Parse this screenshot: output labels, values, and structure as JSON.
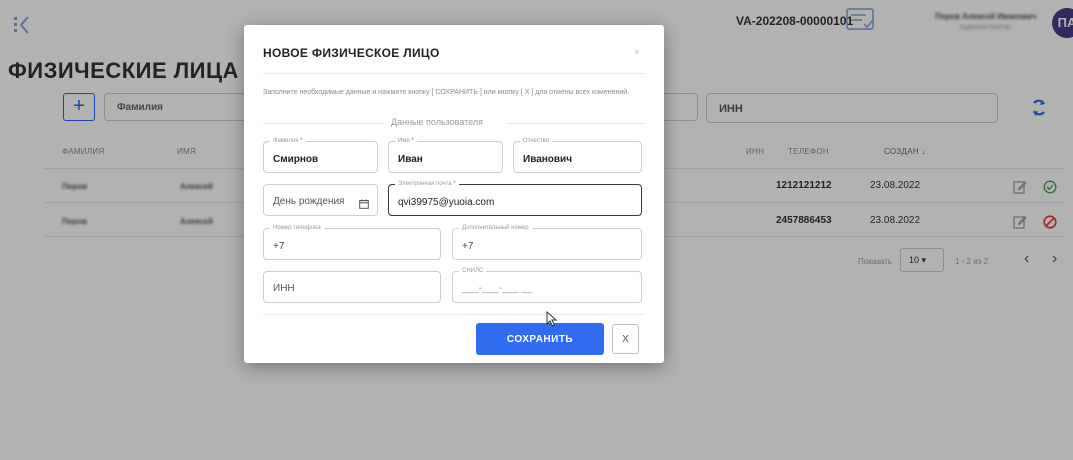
{
  "header": {
    "order_id": "VA-202208-00000101",
    "user_name": "Перов Алексей Иванович",
    "user_subtitle": "Администратор",
    "avatar_initials": "ПА"
  },
  "page": {
    "title": "ФИЗИЧЕСКИЕ ЛИЦА"
  },
  "filters": {
    "add_label": "+",
    "lastname_placeholder": "Фамилия",
    "inn_placeholder": "ИНН"
  },
  "table": {
    "headers": {
      "lastname": "ФАМИЛИЯ",
      "firstname": "ИМЯ",
      "inn": "ИНН",
      "phone": "ТЕЛЕФОН",
      "created": "СОЗДАН ↓"
    },
    "rows": [
      {
        "lastname": "Перов",
        "firstname": "Алексей",
        "phone": "1212121212",
        "created": "23.08.2022",
        "status": "active"
      },
      {
        "lastname": "Перов",
        "firstname": "Алексей",
        "phone": "2457886453",
        "created": "23.08.2022",
        "status": "blocked"
      }
    ]
  },
  "pagination": {
    "show_label": "Показать",
    "page_size": "10 ▾",
    "range": "1 - 2 из 2",
    "prev": "‹",
    "next": "›"
  },
  "modal": {
    "title": "НОВОЕ ФИЗИЧЕСКОЕ ЛИЦО",
    "close": "×",
    "instruction": "Заполните необходимые данные и нажмите кнопку [ СОХРАНИТЬ ] или кнопку [ X ] для отмены всех изменений.",
    "section_title": "Данные пользователя",
    "fields": {
      "lastname": {
        "label": "Фамилия",
        "required": "*",
        "value": "Смирнов"
      },
      "firstname": {
        "label": "Имя",
        "required": "*",
        "value": "Иван"
      },
      "patronymic": {
        "label": "Отчество",
        "value": "Иванович"
      },
      "birthday": {
        "placeholder": "День рождения"
      },
      "email": {
        "label": "Электронная почта",
        "required": "*",
        "value": "qvi39975@yuoia.com"
      },
      "phone": {
        "label": "Номер телефона",
        "value": "+7"
      },
      "extra_phone": {
        "label": "Дополнительный номер",
        "value": "+7"
      },
      "inn": {
        "placeholder": "ИНН"
      },
      "snils": {
        "label": "СНИЛС",
        "placeholder": "___-___-___ __"
      }
    },
    "save_label": "СОХРАНИТЬ",
    "cancel_label": "X"
  },
  "colors": {
    "accent": "#2f6cf0",
    "avatar_bg": "#4a3a8a",
    "required": "#e53935",
    "status_ok": "#43a047",
    "status_blocked": "#e53935"
  }
}
